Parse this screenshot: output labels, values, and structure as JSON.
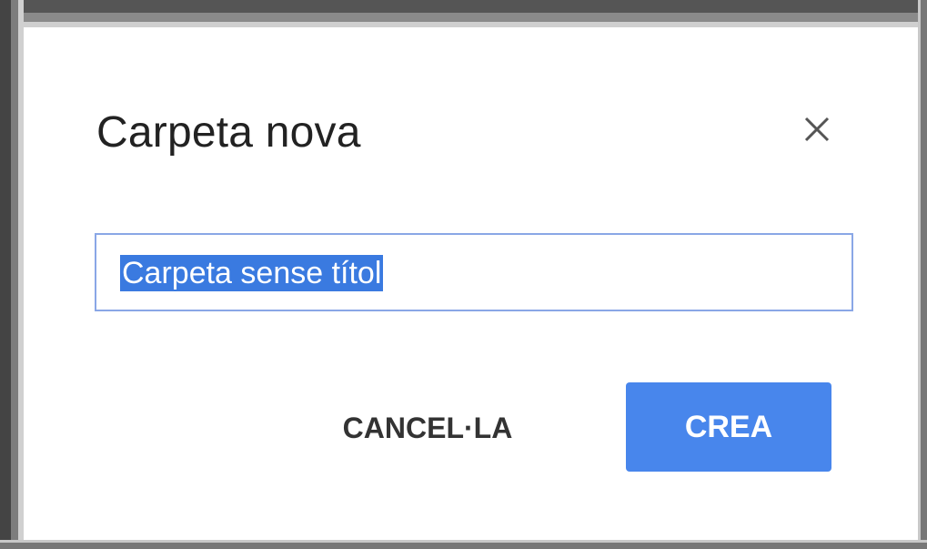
{
  "dialog": {
    "title": "Carpeta nova",
    "close_icon": "close-icon",
    "folder_name_value": "Carpeta sense títol",
    "cancel_label": "CANCEL·LA",
    "create_label": "CREA"
  },
  "colors": {
    "primary_button": "#4886ec",
    "selection": "#3a7ae0",
    "input_border": "#8aa7e6",
    "title_text": "#222222"
  }
}
